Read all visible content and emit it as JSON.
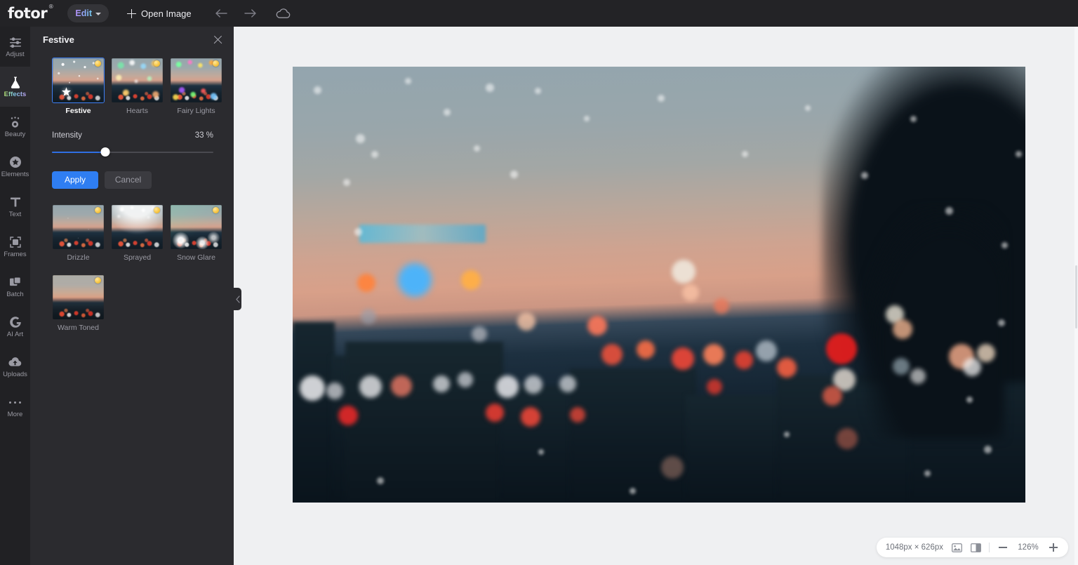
{
  "app": {
    "brand": "fotor",
    "brand_reg": "®"
  },
  "topbar": {
    "edit_label": "Edit",
    "open_image_label": "Open Image",
    "undo_icon": "arrow-left-icon",
    "redo_icon": "arrow-right-icon",
    "cloud_icon": "cloud-icon"
  },
  "rail": {
    "items": [
      {
        "label": "Adjust",
        "icon": "sliders-icon",
        "active": false
      },
      {
        "label": "Effects",
        "icon": "flask-icon",
        "active": true
      },
      {
        "label": "Beauty",
        "icon": "eye-icon",
        "active": false
      },
      {
        "label": "Elements",
        "icon": "star-badge-icon",
        "active": false
      },
      {
        "label": "Text",
        "icon": "text-t-icon",
        "active": false
      },
      {
        "label": "Frames",
        "icon": "frame-icon",
        "active": false
      },
      {
        "label": "Batch",
        "icon": "batch-icon",
        "active": false
      },
      {
        "label": "AI Art",
        "icon": "ai-art-icon",
        "active": false
      },
      {
        "label": "Uploads",
        "icon": "upload-cloud-icon",
        "active": false
      },
      {
        "label": "More",
        "icon": "ellipsis-icon",
        "active": false
      }
    ]
  },
  "panel": {
    "title": "Festive",
    "close_icon": "close-icon",
    "collapse_icon": "chevron-left-icon",
    "effects": [
      {
        "name": "Festive",
        "premium": true,
        "selected": true,
        "style": "ov-festive"
      },
      {
        "name": "Hearts",
        "premium": true,
        "selected": false,
        "style": "ov-hearts"
      },
      {
        "name": "Fairy Lights",
        "premium": true,
        "selected": false,
        "style": "ov-fairy"
      },
      {
        "name": "Drizzle",
        "premium": true,
        "selected": false,
        "style": "ov-drizzle"
      },
      {
        "name": "Sprayed",
        "premium": true,
        "selected": false,
        "style": "ov-sprayed"
      },
      {
        "name": "Snow Glare",
        "premium": true,
        "selected": false,
        "style": "ov-snowglare"
      },
      {
        "name": "Warm Toned",
        "premium": true,
        "selected": false,
        "style": "ov-warm"
      }
    ],
    "intensity": {
      "label": "Intensity",
      "value_text": "33 %",
      "value": 33,
      "min": 0,
      "max": 100
    },
    "apply_label": "Apply",
    "cancel_label": "Cancel"
  },
  "statusbar": {
    "dimensions": "1048px × 626px",
    "image_icon": "picture-icon",
    "compare_icon": "compare-split-icon",
    "zoom_out_icon": "minus-icon",
    "zoom_in_icon": "plus-icon",
    "zoom_level": "126%"
  },
  "colors": {
    "accent_blue": "#2f7ef2",
    "topbar_bg": "#232326",
    "rail_bg": "#212124",
    "panel_bg": "#2b2b2f",
    "canvas_bg": "#eff0f2",
    "premium_badge": "#f7c645"
  }
}
